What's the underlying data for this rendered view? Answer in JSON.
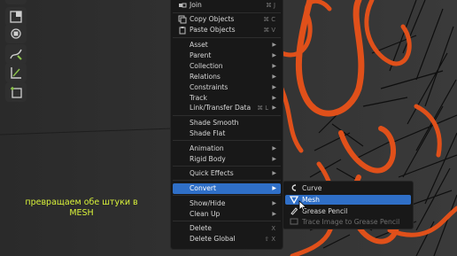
{
  "menu": {
    "items": [
      {
        "label": "Join",
        "shortcut": "⌘ J"
      },
      {
        "label": "Copy Objects",
        "shortcut": "⌘ C"
      },
      {
        "label": "Paste Objects",
        "shortcut": "⌘ V"
      },
      {
        "label": "Asset"
      },
      {
        "label": "Parent"
      },
      {
        "label": "Collection"
      },
      {
        "label": "Relations"
      },
      {
        "label": "Constraints"
      },
      {
        "label": "Track"
      },
      {
        "label": "Link/Transfer Data",
        "shortcut": "⌘ L"
      },
      {
        "label": "Shade Smooth"
      },
      {
        "label": "Shade Flat"
      },
      {
        "label": "Animation"
      },
      {
        "label": "Rigid Body"
      },
      {
        "label": "Quick Effects"
      },
      {
        "label": "Convert",
        "highlighted": true
      },
      {
        "label": "Show/Hide"
      },
      {
        "label": "Clean Up"
      },
      {
        "label": "Delete",
        "shortcut": "X"
      },
      {
        "label": "Delete Global",
        "shortcut": "⇧ X"
      }
    ]
  },
  "convert_submenu": {
    "items": [
      {
        "label": "Curve",
        "icon": "curve-icon"
      },
      {
        "label": "Mesh",
        "icon": "mesh-icon",
        "highlighted": true
      },
      {
        "label": "Grease Pencil",
        "icon": "grease-pencil-icon"
      },
      {
        "label": "Trace Image to Grease Pencil",
        "icon": "trace-icon",
        "disabled": true
      }
    ]
  },
  "subtitle": {
    "line1": "превращаем обе штуки в",
    "line2": "MESH"
  },
  "toolbar": {
    "tools": [
      "scale-icon",
      "transform-icon",
      "annotate-icon",
      "measure-icon",
      "add-cube-icon"
    ]
  },
  "colors": {
    "menu_bg": "#181818",
    "highlight": "#2f6fc7",
    "viewport_bg": "#2b2b2b",
    "subtitle": "#d9f23a",
    "curve_orange": "#e0501a"
  }
}
